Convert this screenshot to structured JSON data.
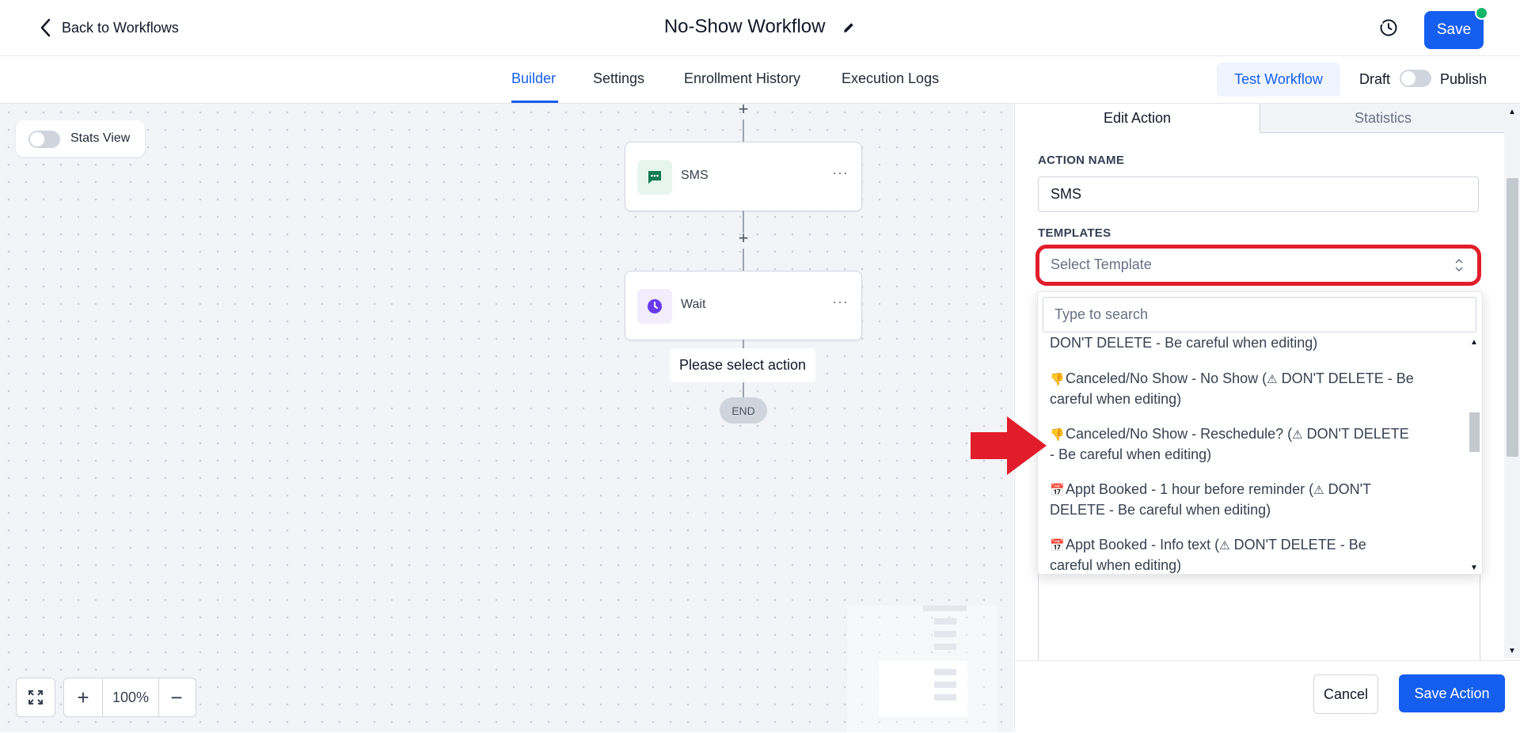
{
  "header": {
    "back_label": "Back to Workflows",
    "title": "No-Show Workflow",
    "save_label": "Save"
  },
  "subnav": {
    "tabs": [
      {
        "label": "Builder",
        "active": true
      },
      {
        "label": "Settings",
        "active": false
      },
      {
        "label": "Enrollment History",
        "active": false
      },
      {
        "label": "Execution Logs",
        "active": false
      }
    ],
    "test_label": "Test Workflow",
    "draft_label": "Draft",
    "publish_label": "Publish"
  },
  "canvas": {
    "stats_view_label": "Stats View",
    "nodes": [
      {
        "label": "SMS",
        "icon": "chat-icon"
      },
      {
        "label": "Wait",
        "icon": "clock-icon"
      }
    ],
    "placeholder": "Please select action",
    "end_label": "END",
    "zoom_label": "100%",
    "plus": "+",
    "minus": "−"
  },
  "panel": {
    "tabs": {
      "edit": "Edit Action",
      "stats": "Statistics"
    },
    "action_name_label": "ACTION NAME",
    "action_name_value": "SMS",
    "templates_label": "TEMPLATES",
    "template_placeholder": "Select Template",
    "dropdown": {
      "search_placeholder": "Type to search",
      "items": [
        {
          "emoji": "",
          "text": "DON'T DELETE - Be careful when editing)"
        },
        {
          "emoji": "👎",
          "line1": "Canceled/No Show - No Show (",
          "line1b": " DON'T DELETE - Be",
          "line2": "careful when editing)"
        },
        {
          "emoji": "👎",
          "line1": "Canceled/No Show - Reschedule? (",
          "line1b": " DON'T DELETE",
          "line2": "- Be careful when editing)"
        },
        {
          "emoji": "📅",
          "line1": "Appt Booked - 1 hour before reminder (",
          "line1b": " DON'T",
          "line2": "DELETE - Be careful when editing)"
        },
        {
          "emoji": "📅",
          "line1": "Appt Booked - Info text (",
          "line1b": " DON'T DELETE - Be",
          "line2": "careful when editing)"
        }
      ]
    },
    "cancel_label": "Cancel",
    "save_action_label": "Save Action"
  },
  "colors": {
    "accent": "#155eef",
    "highlight": "#e11d2b",
    "canvas_bg": "#f2f4f8",
    "sms_icon_bg": "#e6f6ef",
    "wait_icon_bg": "#f1edfc"
  }
}
